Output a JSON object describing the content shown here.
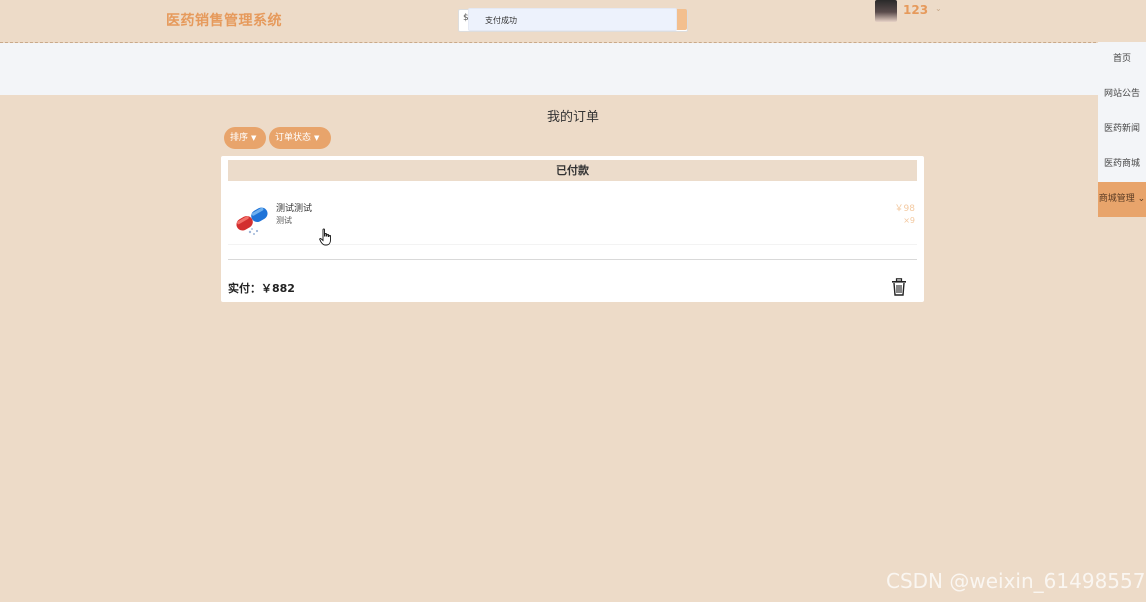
{
  "header": {
    "app_title": "医药销售管理系统",
    "search_prefix": "$",
    "toast_message": "支付成功",
    "user_name": "123",
    "user_caret": "⌄"
  },
  "side_nav": {
    "items": [
      {
        "label": "首页"
      },
      {
        "label": "网站公告"
      },
      {
        "label": "医药新闻"
      },
      {
        "label": "医药商城"
      },
      {
        "label": "商城管理 ⌄",
        "active": true
      }
    ]
  },
  "orders_page": {
    "heading": "我的订单",
    "sort_label": "排序",
    "status_filter_label": "订单状态"
  },
  "order": {
    "status": "已付款",
    "item": {
      "name": "测试测试",
      "description": "测试",
      "price": "￥98",
      "quantity": "×9"
    },
    "total_label": "实付：￥882"
  },
  "watermark": "CSDN @weixin_61498557",
  "colors": {
    "accent": "#e8a46b",
    "background": "#eddbc8",
    "title": "#e69a5c"
  }
}
